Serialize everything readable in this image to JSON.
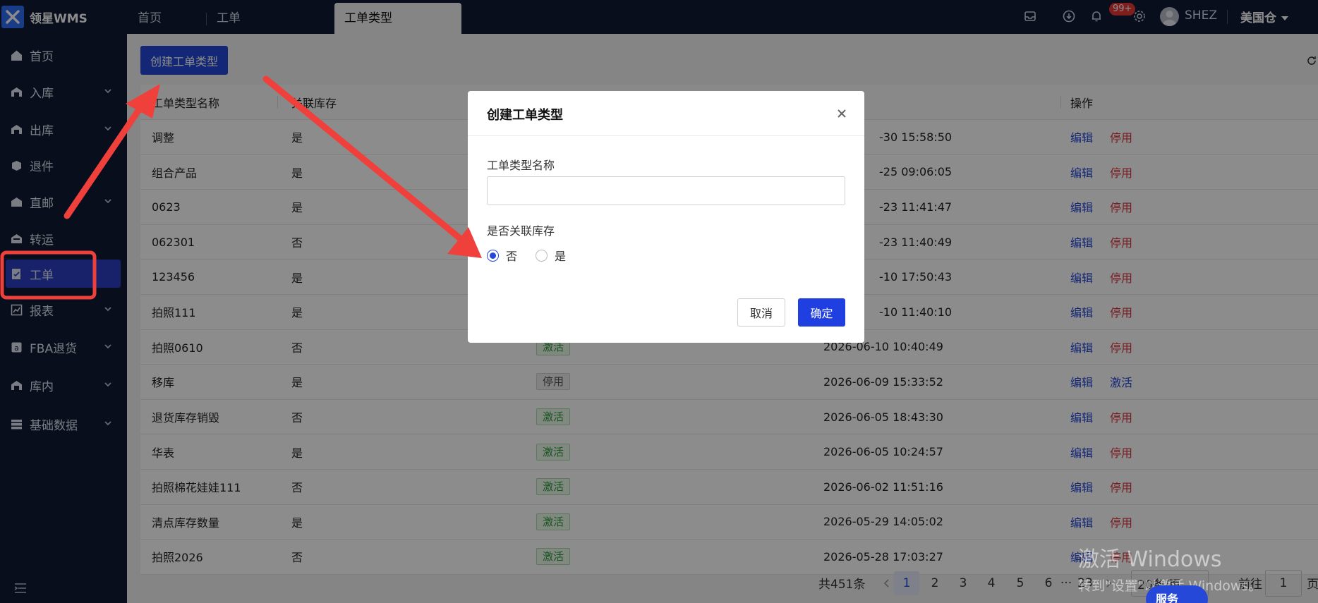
{
  "app": {
    "logo_text": "领星WMS"
  },
  "tabs": [
    {
      "label": "首页"
    },
    {
      "label": "工单"
    },
    {
      "label": "工单类型"
    }
  ],
  "header": {
    "notification_count": "99+",
    "username": "SHEZ",
    "warehouse": "美国仓"
  },
  "sidebar": {
    "items": [
      {
        "label": "首页",
        "icon": "home-icon",
        "expandable": false
      },
      {
        "label": "入库",
        "icon": "inbound-icon",
        "expandable": true
      },
      {
        "label": "出库",
        "icon": "outbound-icon",
        "expandable": true
      },
      {
        "label": "退件",
        "icon": "return-icon",
        "expandable": false
      },
      {
        "label": "直邮",
        "icon": "direct-mail-icon",
        "expandable": true
      },
      {
        "label": "转运",
        "icon": "transfer-icon",
        "expandable": false
      },
      {
        "label": "工单",
        "icon": "work-order-icon",
        "expandable": false,
        "active": true
      },
      {
        "label": "报表",
        "icon": "report-icon",
        "expandable": true
      },
      {
        "label": "FBA退货",
        "icon": "fba-return-icon",
        "expandable": true
      },
      {
        "label": "库内",
        "icon": "in-warehouse-icon",
        "expandable": true
      },
      {
        "label": "基础数据",
        "icon": "base-data-icon",
        "expandable": true
      }
    ]
  },
  "main": {
    "create_button": "创建工单类型",
    "table": {
      "columns": [
        "工单类型名称",
        "关联库存",
        "",
        "",
        "操作"
      ],
      "rows": [
        {
          "name": "调整",
          "linked": "是",
          "status": "",
          "time": "-30 15:58:50",
          "edit": "编辑",
          "toggle": "停用"
        },
        {
          "name": "组合产品",
          "linked": "是",
          "status": "",
          "time": "-25 09:06:05",
          "edit": "编辑",
          "toggle": "停用"
        },
        {
          "name": "0623",
          "linked": "是",
          "status": "",
          "time": "-23 11:41:47",
          "edit": "编辑",
          "toggle": "停用"
        },
        {
          "name": "062301",
          "linked": "否",
          "status": "",
          "time": "-23 11:40:49",
          "edit": "编辑",
          "toggle": "停用"
        },
        {
          "name": "123456",
          "linked": "是",
          "status": "",
          "time": "-10 17:50:43",
          "edit": "编辑",
          "toggle": "停用"
        },
        {
          "name": "拍照111",
          "linked": "是",
          "status": "",
          "time": "-10 11:40:10",
          "edit": "编辑",
          "toggle": "停用"
        },
        {
          "name": "拍照0610",
          "linked": "否",
          "status": "激活",
          "time": "2026-06-10 10:40:49",
          "edit": "编辑",
          "toggle": "停用"
        },
        {
          "name": "移库",
          "linked": "是",
          "status": "停用",
          "time": "2026-06-09 15:33:52",
          "edit": "编辑",
          "toggle": "激活"
        },
        {
          "name": "退货库存销毁",
          "linked": "否",
          "status": "激活",
          "time": "2026-06-05 18:43:30",
          "edit": "编辑",
          "toggle": "停用"
        },
        {
          "name": "华表",
          "linked": "是",
          "status": "激活",
          "time": "2026-06-05 10:24:57",
          "edit": "编辑",
          "toggle": "停用"
        },
        {
          "name": "拍照棉花娃娃111",
          "linked": "否",
          "status": "激活",
          "time": "2026-06-02 11:51:16",
          "edit": "编辑",
          "toggle": "停用"
        },
        {
          "name": "清点库存数量",
          "linked": "是",
          "status": "激活",
          "time": "2026-05-29 14:05:02",
          "edit": "编辑",
          "toggle": "停用"
        },
        {
          "name": "拍照2026",
          "linked": "否",
          "status": "激活",
          "time": "2026-05-28 17:03:27",
          "edit": "编辑",
          "toggle": "停用"
        }
      ]
    },
    "pagination": {
      "total": "共451条",
      "pages": [
        "1",
        "2",
        "3",
        "4",
        "5",
        "6",
        "23"
      ],
      "current": "1",
      "ellipsis": "···",
      "page_size": "20条/页",
      "goto_label": "前往",
      "goto_value": "1",
      "page_suffix": "页"
    }
  },
  "modal": {
    "title": "创建工单类型",
    "name_label": "工单类型名称",
    "name_value": "",
    "linked_label": "是否关联库存",
    "options": [
      {
        "label": "否",
        "selected": true
      },
      {
        "label": "是",
        "selected": false
      }
    ],
    "cancel": "取消",
    "confirm": "确定"
  },
  "overlay": {
    "windows_watermark_line1": "激活 Windows",
    "windows_watermark_line2": "转到\"设置\"以激活 Windows。",
    "service_button": "服务"
  },
  "colors": {
    "sidebar_bg": "#0f1a33",
    "primary": "#2548d8",
    "danger": "#d9363e",
    "annotation": "#f0403c"
  }
}
